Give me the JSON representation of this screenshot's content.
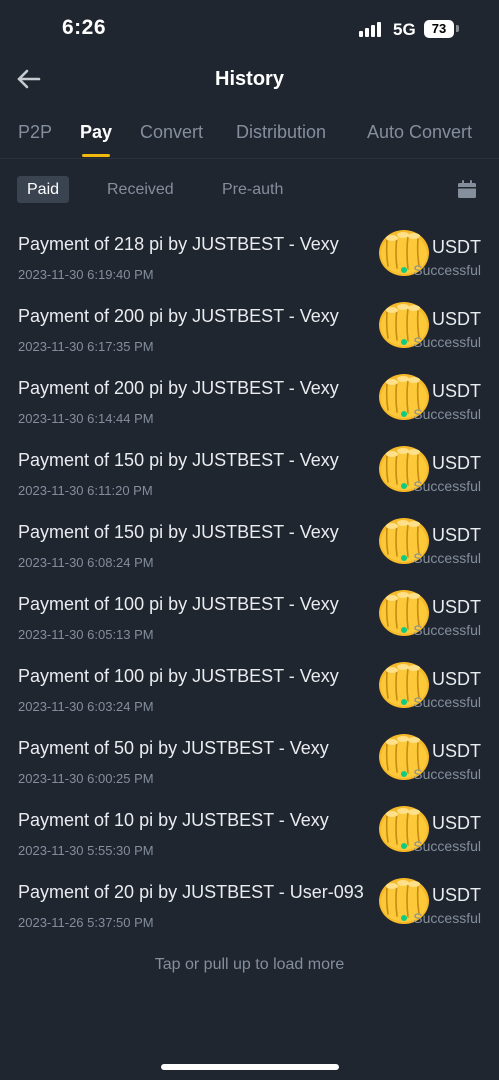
{
  "status_bar": {
    "time": "6:26",
    "network": "5G",
    "battery": "73"
  },
  "header": {
    "title": "History",
    "back_icon": "arrow-left-icon"
  },
  "tabs": [
    {
      "label": "P2P",
      "active": false
    },
    {
      "label": "Pay",
      "active": true
    },
    {
      "label": "Convert",
      "active": false
    },
    {
      "label": "Distribution",
      "active": false
    },
    {
      "label": "Auto Convert",
      "active": false
    }
  ],
  "filters": [
    {
      "label": "Paid",
      "active": true
    },
    {
      "label": "Received",
      "active": false
    },
    {
      "label": "Pre-auth",
      "active": false
    }
  ],
  "calendar_icon": "calendar-icon",
  "transactions": [
    {
      "title": "Payment of 218 pi by JUSTBEST - Vexy",
      "time": "2023-11-30 6:19:40 PM",
      "currency": "USDT",
      "status": "Successful"
    },
    {
      "title": "Payment of 200 pi by JUSTBEST  - Vexy",
      "time": "2023-11-30 6:17:35 PM",
      "currency": "USDT",
      "status": "Successful"
    },
    {
      "title": "Payment of 200 pi by JUSTBEST - Vexy",
      "time": "2023-11-30 6:14:44 PM",
      "currency": "USDT",
      "status": "Successful"
    },
    {
      "title": "Payment of 150 pi by JUSTBEST - Vexy",
      "time": "2023-11-30 6:11:20 PM",
      "currency": "USDT",
      "status": "Successful"
    },
    {
      "title": "Payment of 150 pi by JUSTBEST  - Vexy",
      "time": "2023-11-30 6:08:24 PM",
      "currency": "USDT",
      "status": "Successful"
    },
    {
      "title": "Payment of 100 pi by JUSTBEST - Vexy",
      "time": "2023-11-30 6:05:13 PM",
      "currency": "USDT",
      "status": "Successful"
    },
    {
      "title": "Payment of 100 pi by JUSTBEST  - Vexy",
      "time": "2023-11-30 6:03:24 PM",
      "currency": "USDT",
      "status": "Successful"
    },
    {
      "title": "Payment of 50 pi by JUSTBEST - Vexy",
      "time": "2023-11-30 6:00:25 PM",
      "currency": "USDT",
      "status": "Successful"
    },
    {
      "title": "Payment of 10 pi by JUSTBEST - Vexy",
      "time": "2023-11-30 5:55:30 PM",
      "currency": "USDT",
      "status": "Successful"
    },
    {
      "title": "Payment of 20 pi by JUSTBEST  - User-093...",
      "time": "2023-11-26 5:37:50 PM",
      "currency": "USDT",
      "status": "Successful"
    }
  ],
  "emoji_icon": "oncoming-fist-icon",
  "load_more": "Tap or pull up to load more",
  "colors": {
    "background": "#1f2630",
    "accent": "#f0b90b",
    "success": "#0ecb81",
    "muted": "#848e9c"
  }
}
